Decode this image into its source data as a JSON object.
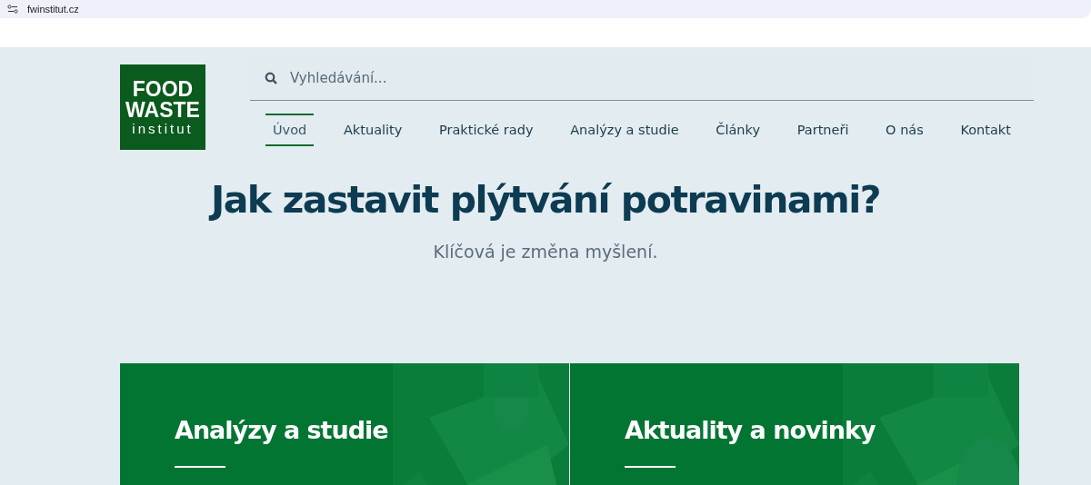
{
  "browser": {
    "url": "fwinstitut.cz"
  },
  "logo": {
    "lines": [
      "FOOD",
      "WASTE",
      "institut"
    ]
  },
  "search": {
    "placeholder": "Vyhledávání..."
  },
  "nav": [
    {
      "label": "Úvod",
      "selected": true
    },
    {
      "label": "Aktuality",
      "selected": false
    },
    {
      "label": "Praktické rady",
      "selected": false
    },
    {
      "label": "Analýzy a studie",
      "selected": false
    },
    {
      "label": "Články",
      "selected": false
    },
    {
      "label": "Partneři",
      "selected": false
    },
    {
      "label": "O nás",
      "selected": false
    },
    {
      "label": "Kontakt",
      "selected": false
    }
  ],
  "hero": {
    "title": "Jak zastavit plýtvání potravinami?",
    "subtitle": "Klíčová je změna myšlení."
  },
  "cards": [
    {
      "title": "Analýzy a studie",
      "kind": "picture"
    },
    {
      "title": "Aktuality a novinky",
      "kind": "picture"
    }
  ]
}
